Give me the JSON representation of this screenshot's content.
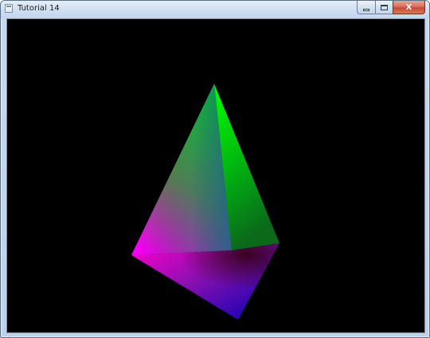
{
  "window": {
    "title": "Tutorial 14",
    "icon": "application-window-icon"
  },
  "caption_buttons": {
    "minimize_icon": "minimize-icon",
    "maximize_icon": "maximize-icon",
    "close_label": "X"
  },
  "scene": {
    "background_color": "#000000",
    "object": "colored-pyramid",
    "vertex_colors": {
      "top": "#00ff00",
      "left": "#ff00ff",
      "right": "#008000",
      "bottom": "#0000a0",
      "center": "#1a5f8c"
    }
  }
}
